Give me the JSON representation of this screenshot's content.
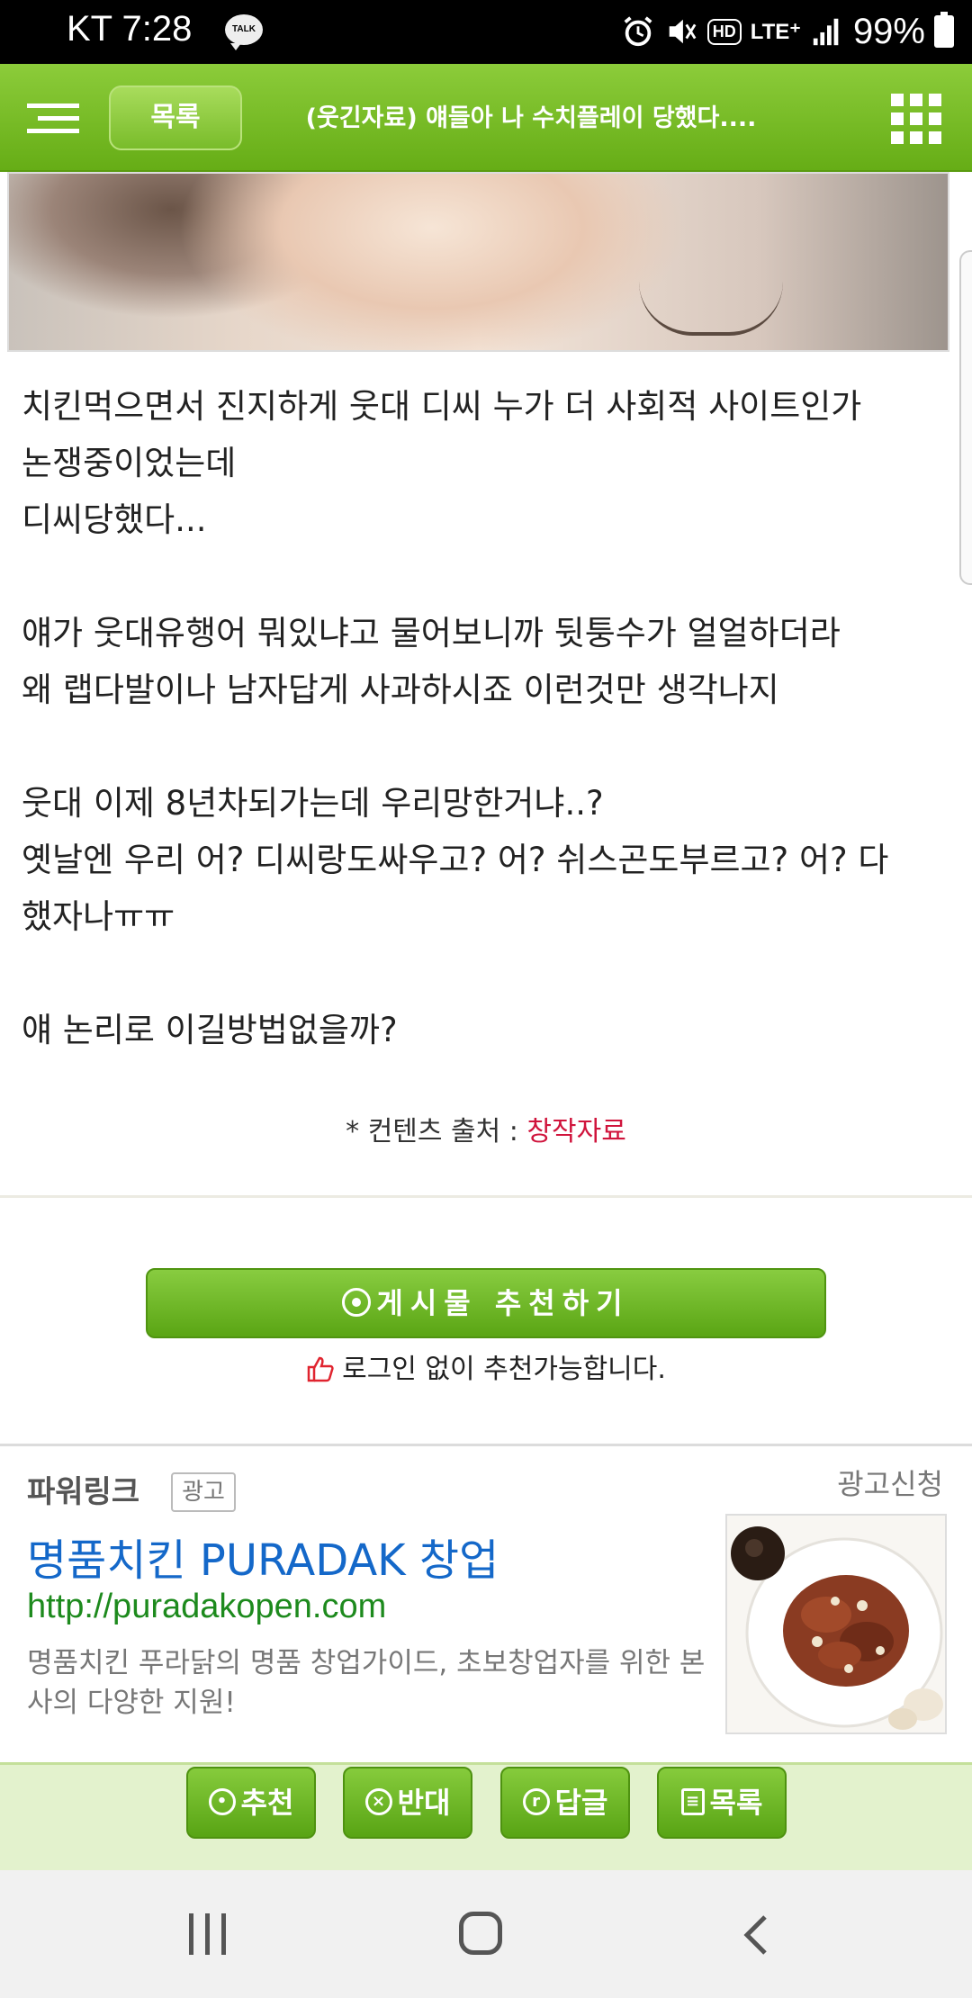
{
  "status_bar": {
    "carrier_time": "KT 7:28",
    "talk_badge": "TALK",
    "hd": "HD",
    "lte": "LTE⁺",
    "battery": "99%"
  },
  "header": {
    "list_button": "목록",
    "title": "(웃긴자료) 얘들아 나 수치플레이 당했다...."
  },
  "article": {
    "paragraphs": [
      "치킨먹으면서 진지하게 웃대 디씨 누가 더 사회적 사이트인가\n논쟁중이었는데\n디씨당했다...",
      "얘가 웃대유행어 뭐있냐고 물어보니까 뒷퉁수가 얼얼하더라\n왜 랩다발이나 남자답게 사과하시죠 이런것만 생각나지",
      "웃대 이제 8년차되가는데 우리망한거냐..?\n옛날엔 우리 어? 디씨랑도싸우고? 어? 쉬스곤도부르고? 어? 다\n했자나ㅠㅠ",
      "얘 논리로 이길방법없을까?"
    ]
  },
  "source": {
    "label": "* 컨텐츠 출처 : ",
    "value": "창작자료"
  },
  "recommend": {
    "button": "게시물  추천하기",
    "note": "로그인 없이 추천가능합니다."
  },
  "ad": {
    "section_label": "파워링크",
    "badge": "광고",
    "apply": "광고신청",
    "title": "명품치킨 PURADAK 창업",
    "url": "http://puradakopen.com",
    "description": "명품치킨 푸라닭의 명품 창업가이드, 초보창업자를 위한 본사의 다양한 지원!"
  },
  "actions": {
    "recommend": "추천",
    "oppose": "반대",
    "reply": "답글",
    "list": "목록"
  },
  "colors": {
    "brand_green": "#66ad16",
    "source_red": "#d0143c",
    "ad_title_blue": "#1468c9",
    "ad_url_green": "#1d8a1d"
  }
}
